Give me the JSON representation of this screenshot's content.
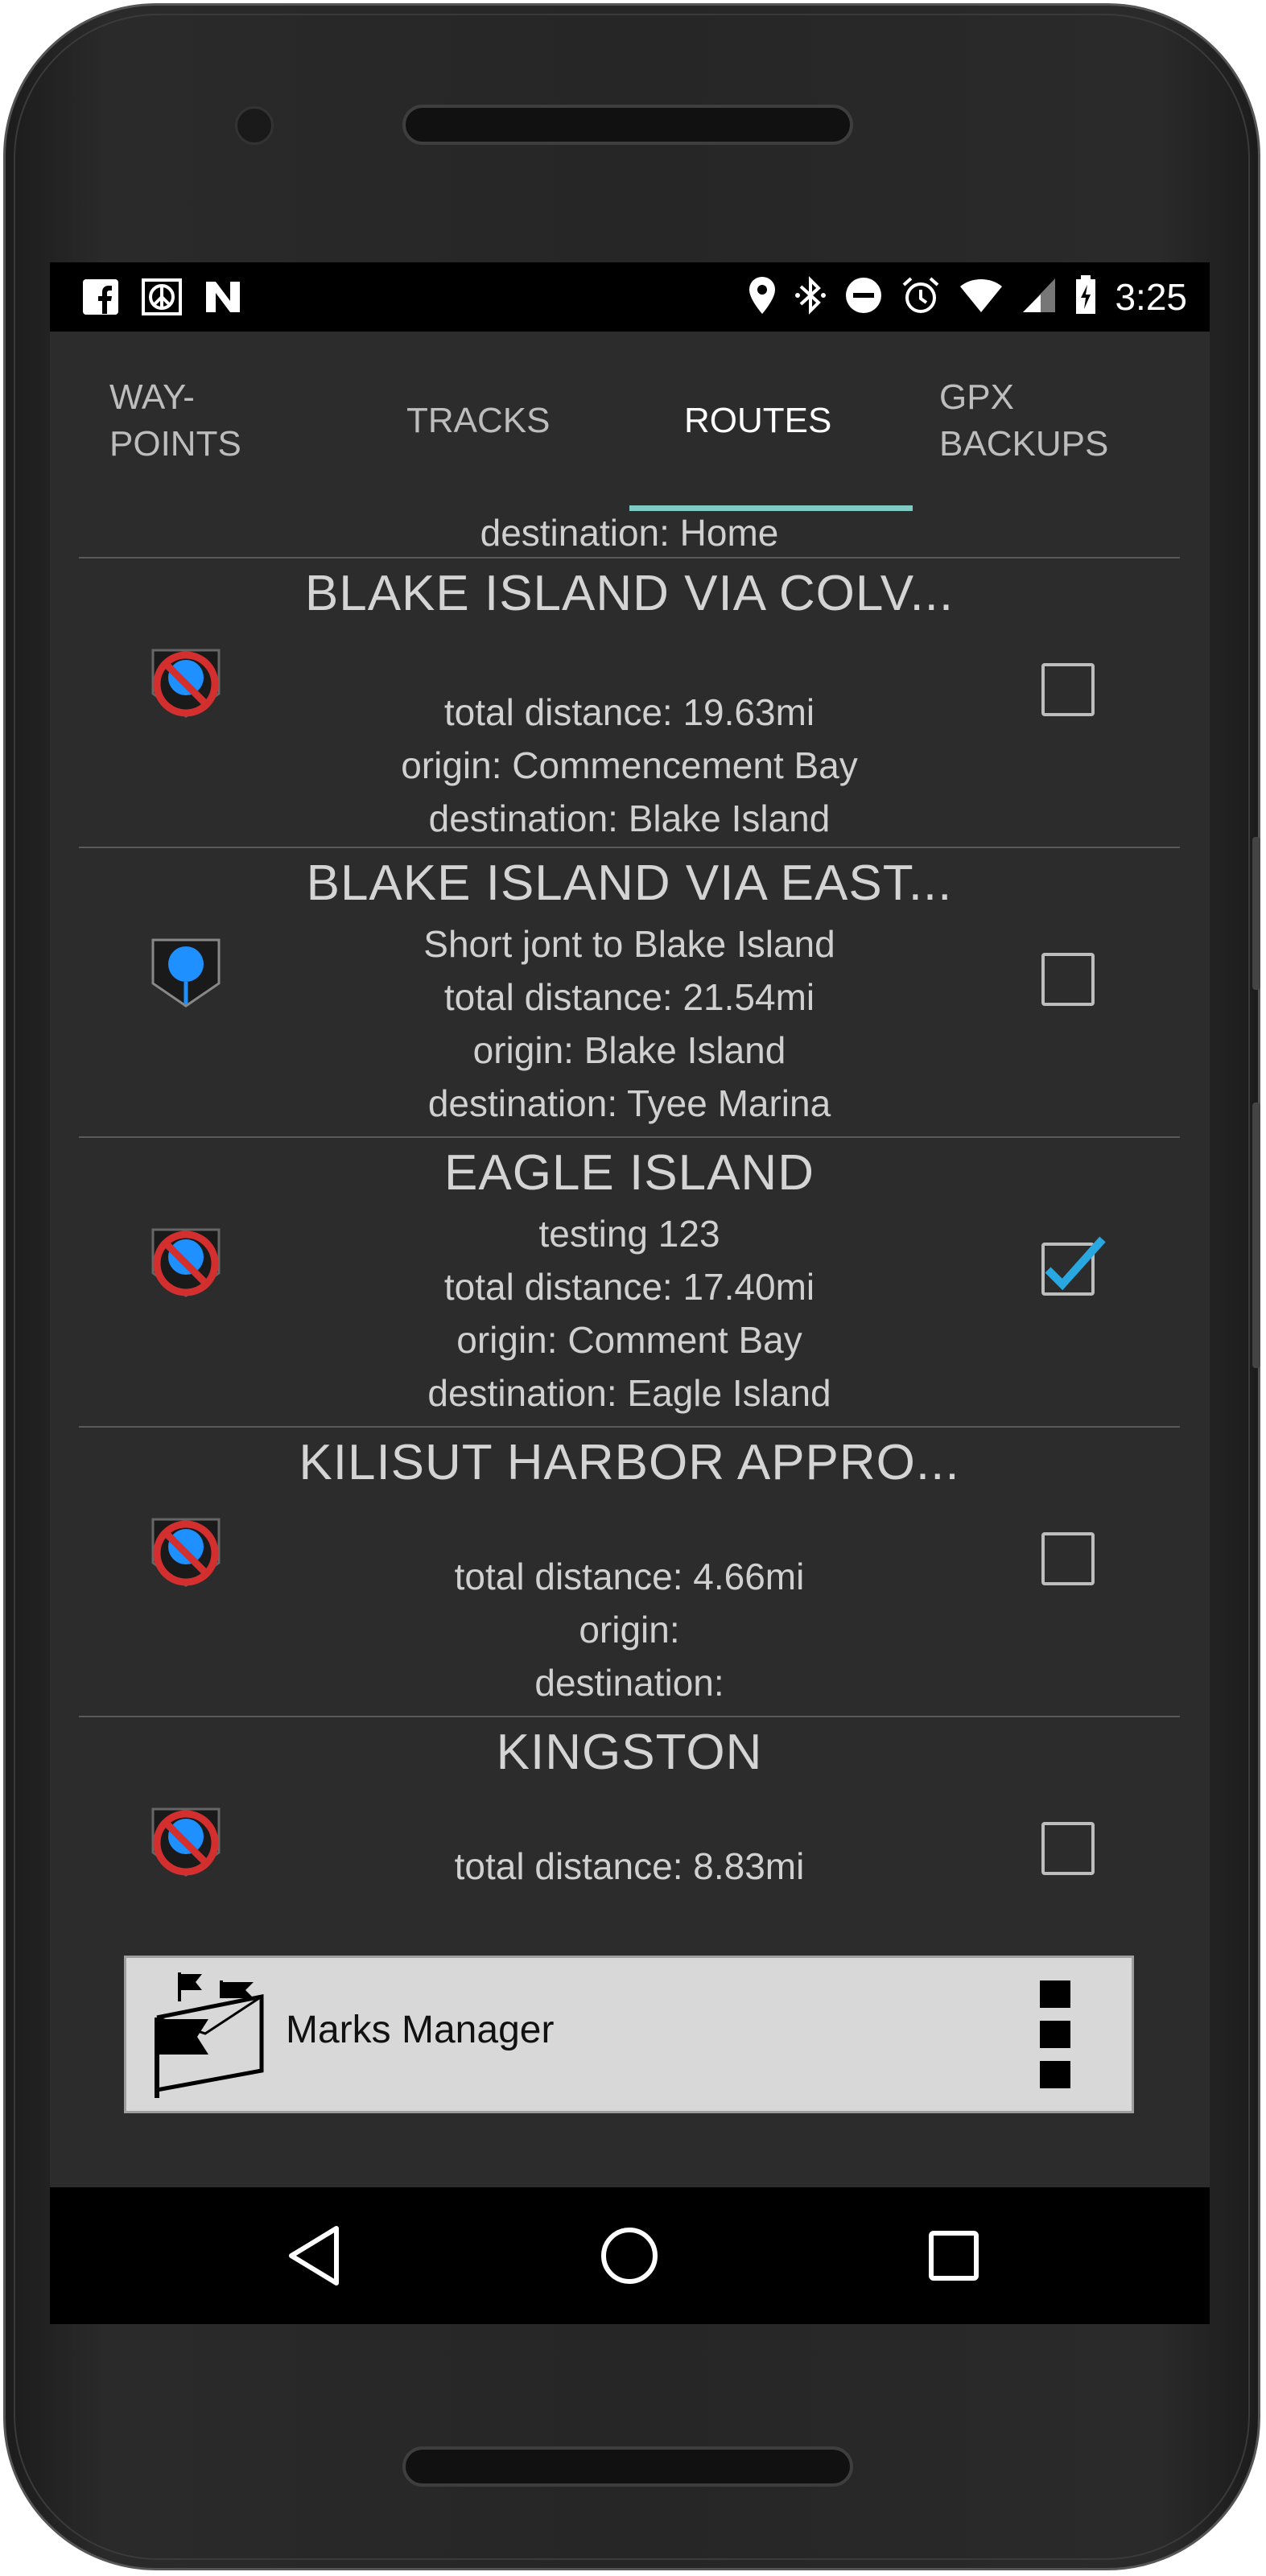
{
  "status_bar": {
    "time": "3:25",
    "left_icons": [
      "facebook-icon",
      "peace-sign-icon",
      "nvidia-icon"
    ],
    "right_icons": [
      "location-icon",
      "bluetooth-icon",
      "do-not-disturb-icon",
      "alarm-icon",
      "wifi-icon",
      "signal-icon",
      "battery-icon"
    ]
  },
  "tabs": [
    {
      "line1": "WAY-",
      "line2": "POINTS",
      "active": false
    },
    {
      "line1": "TRACKS",
      "line2": "",
      "active": true
    },
    {
      "line1": "ROUTES",
      "line2": "",
      "active": true
    },
    {
      "line1": "GPX",
      "line2": "BACKUPS",
      "active": false
    }
  ],
  "previous_row_destination": "destination: Home",
  "routes": [
    {
      "title": "BLAKE ISLAND VIA COLV...",
      "description": "",
      "total_distance": "total distance: 19.63mi",
      "origin": "origin: Commencement Bay",
      "destination": "destination: Blake Island",
      "icon": "route-hidden-icon",
      "checked": false
    },
    {
      "title": "BLAKE ISLAND VIA EAST...",
      "description": "Short jont to Blake Island",
      "total_distance": "total distance: 21.54mi",
      "origin": "origin: Blake Island",
      "destination": "destination: Tyee Marina",
      "icon": "route-visible-icon",
      "checked": false
    },
    {
      "title": "EAGLE ISLAND",
      "description": "testing 123",
      "total_distance": "total distance: 17.40mi",
      "origin": "origin: Comment Bay",
      "destination": "destination: Eagle Island",
      "icon": "route-hidden-icon",
      "checked": true
    },
    {
      "title": "KILISUT HARBOR APPRO...",
      "description": "",
      "total_distance": "total distance: 4.66mi",
      "origin": "origin:",
      "destination": "destination:",
      "icon": "route-hidden-icon",
      "checked": false
    },
    {
      "title": "KINGSTON",
      "description": "",
      "total_distance": "total distance: 8.83mi",
      "origin": "",
      "destination": "",
      "icon": "route-hidden-icon",
      "checked": false
    }
  ],
  "marks_manager": {
    "label": "Marks Manager"
  },
  "colors": {
    "screen_bg": "#2c2c2c",
    "tab_indicator": "#80cbc4",
    "checkbox_check": "#29a7e1",
    "forbidden_red": "#d32f2f",
    "pin_blue": "#1e90ff"
  }
}
